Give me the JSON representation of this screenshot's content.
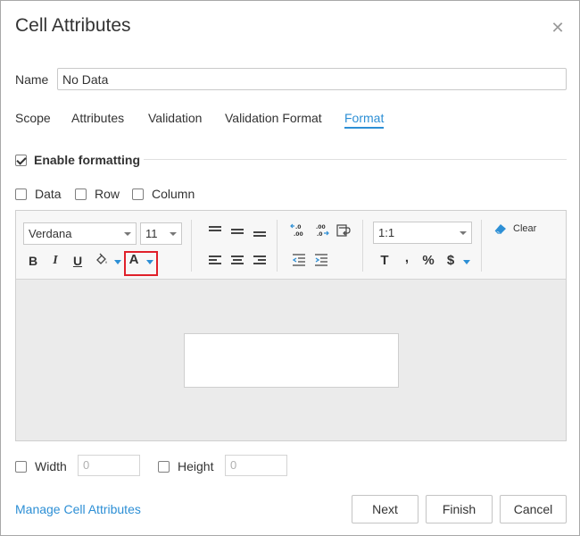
{
  "dialog": {
    "title": "Cell Attributes",
    "close_icon": "close-icon"
  },
  "name": {
    "label": "Name",
    "value": "No Data"
  },
  "tabs": [
    {
      "label": "Scope",
      "active": false
    },
    {
      "label": "Attributes",
      "active": false
    },
    {
      "label": "Validation",
      "active": false
    },
    {
      "label": "Validation Format",
      "active": false
    },
    {
      "label": "Format",
      "active": true
    }
  ],
  "format": {
    "enable_label": "Enable formatting",
    "enable_checked": true,
    "scope_options": [
      {
        "label": "Data",
        "checked": false
      },
      {
        "label": "Row",
        "checked": false
      },
      {
        "label": "Column",
        "checked": false
      }
    ]
  },
  "toolbar": {
    "font_family": "Verdana",
    "font_size": "11",
    "bold": "B",
    "italic": "I",
    "underline": "U",
    "font_color_glyph": "A",
    "ratio": "1:1",
    "text_format_glyph": "T",
    "comma_glyph": ",",
    "percent_glyph": "%",
    "currency_glyph": "$",
    "clear_label": "Clear",
    "icons": [
      "bold-icon",
      "italic-icon",
      "underline-icon",
      "fill-color-icon",
      "font-color-icon",
      "align-top-icon",
      "align-middle-icon",
      "align-bottom-icon",
      "align-left-icon",
      "align-center-icon",
      "align-right-icon",
      "increase-decimal-icon",
      "decrease-decimal-icon",
      "wrap-text-icon",
      "decrease-indent-icon",
      "increase-indent-icon",
      "eraser-icon"
    ],
    "accent": "#2d8fd5",
    "highlight_color": "#e0202a"
  },
  "size": {
    "width_label": "Width",
    "width_placeholder": "0",
    "height_label": "Height",
    "height_placeholder": "0"
  },
  "footer": {
    "manage_link": "Manage Cell Attributes",
    "next": "Next",
    "finish": "Finish",
    "cancel": "Cancel"
  }
}
